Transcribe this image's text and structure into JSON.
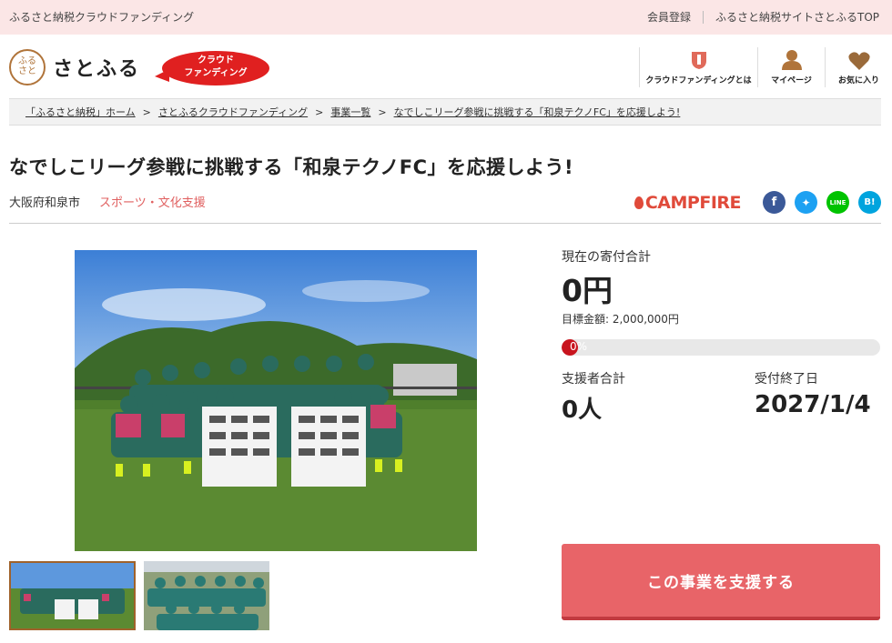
{
  "topbar": {
    "site_title": "ふるさと納税クラウドファンディング",
    "register": "会員登録",
    "satofull_top": "ふるさと納税サイトさとふるTOP"
  },
  "header": {
    "logo_mark": "ふるさと",
    "logo_text": "さとふる",
    "cf_badge": [
      "クラウド",
      "ファンディング"
    ],
    "nav": [
      {
        "label": "クラウドファンディングとは",
        "icon": "shield-icon"
      },
      {
        "label": "マイページ",
        "icon": "person-icon"
      },
      {
        "label": "お気に入り",
        "icon": "heart-icon"
      }
    ]
  },
  "breadcrumb": [
    "「ふるさと納税」ホーム",
    "さとふるクラウドファンディング",
    "事業一覧",
    "なでしこリーグ参戦に挑戦する「和泉テクノFC」を応援しよう!"
  ],
  "project": {
    "title": "なでしこリーグ参戦に挑戦する「和泉テクノFC」を応援しよう!",
    "city": "大阪府和泉市",
    "category": "スポーツ・文化支援"
  },
  "share": {
    "campfire": "CAMPFIRE",
    "buttons": [
      {
        "name": "facebook-icon",
        "glyph": "f",
        "color": "#3b5998"
      },
      {
        "name": "twitter-icon",
        "glyph": "✦",
        "color": "#1da1f2"
      },
      {
        "name": "line-icon",
        "glyph": "LINE",
        "color": "#00c300"
      },
      {
        "name": "hatena-icon",
        "glyph": "B!",
        "color": "#00a4de"
      }
    ]
  },
  "stats": {
    "total_label": "現在の寄付合計",
    "total_value": "0円",
    "goal_label": "目標金額: 2,000,000円",
    "progress_text": "0%",
    "progress_fraction": 0,
    "supporters_label": "支援者合計",
    "supporters_value": "0人",
    "deadline_label": "受付終了日",
    "deadline_value": "2027/1/4"
  },
  "support_button": "この事業を支援する",
  "colors": {
    "accent_red": "#e02020",
    "button": "#e86468",
    "category": "#e06060",
    "topbar_bg": "#fbe6e6"
  }
}
